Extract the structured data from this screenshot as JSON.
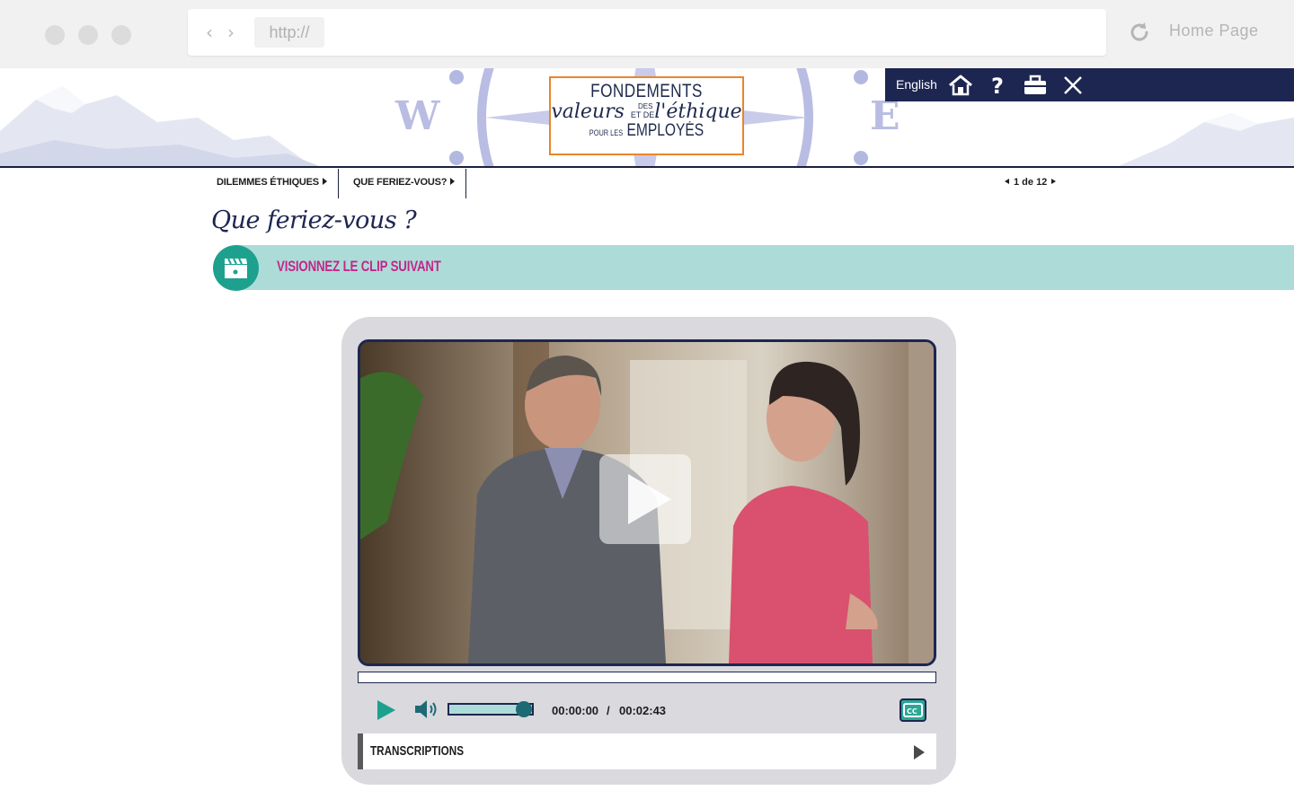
{
  "browser": {
    "url": "http://",
    "home_label": "Home Page"
  },
  "header": {
    "logo": {
      "line1": "FONDEMENTS",
      "des": "DES",
      "word_values": "valeurs",
      "et_de": "ET DE",
      "word_ethics": "l'éthique",
      "pour_les": "POUR LES",
      "word_employees": "EMPLOYÉS"
    },
    "language_label": "English",
    "icons": [
      "home-icon",
      "help-icon",
      "toolbox-icon",
      "close-icon"
    ]
  },
  "breadcrumb": {
    "items": [
      {
        "label": "DILEMMES ÉTHIQUES"
      },
      {
        "label": "QUE FERIEZ-VOUS?"
      }
    ],
    "pager": "1 de 12"
  },
  "page": {
    "title": "Que feriez-vous ?",
    "instruction": "VISIONNEZ LE CLIP SUIVANT"
  },
  "player": {
    "current_time": "00:00:00",
    "separator": "/",
    "duration": "00:02:43",
    "progress": 0,
    "volume": 0.85,
    "transcripts_label": "TRANSCRIPTIONS"
  },
  "colors": {
    "navy": "#1d2651",
    "teal": "#1da18e",
    "band": "#addcd8",
    "magenta": "#c2278a",
    "logo_border": "#e9852b"
  }
}
